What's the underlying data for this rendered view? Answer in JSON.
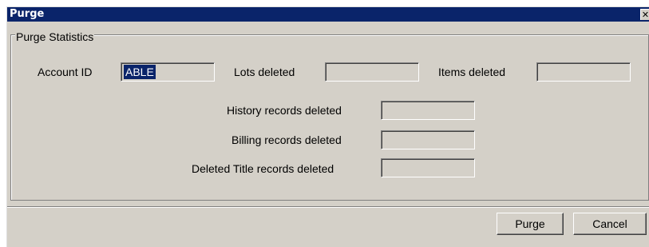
{
  "window": {
    "title": "Purge",
    "close_glyph": "✕"
  },
  "group": {
    "label": "Purge Statistics"
  },
  "fields": {
    "account_id": {
      "label": "Account ID",
      "value": "ABLE"
    },
    "lots_deleted": {
      "label": "Lots deleted",
      "value": ""
    },
    "items_deleted": {
      "label": "Items deleted",
      "value": ""
    },
    "history_records": {
      "label": "History records deleted",
      "value": ""
    },
    "billing_records": {
      "label": "Billing records deleted",
      "value": ""
    },
    "deleted_title_records": {
      "label": "Deleted Title records deleted",
      "value": ""
    }
  },
  "buttons": {
    "purge": "Purge",
    "cancel": "Cancel"
  },
  "colors": {
    "titlebar": "#0a246a",
    "face": "#d4d0c8",
    "selection": "#0a246a"
  }
}
